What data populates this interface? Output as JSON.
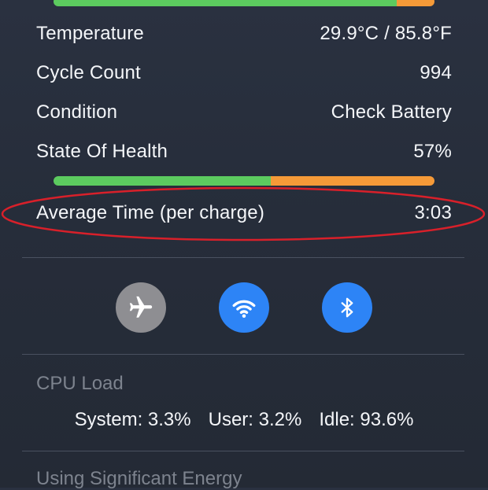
{
  "battery": {
    "top_bar_green_fraction": 0.9,
    "temperature": {
      "label": "Temperature",
      "value": "29.9°C / 85.8°F"
    },
    "cycle_count": {
      "label": "Cycle Count",
      "value": "994"
    },
    "condition": {
      "label": "Condition",
      "value": "Check Battery"
    },
    "state_of_health": {
      "label": "State Of Health",
      "value": "57%",
      "fraction": 0.57
    },
    "average_time": {
      "label": "Average Time (per charge)",
      "value": "3:03"
    }
  },
  "toggles": {
    "airplane": {
      "icon": "airplane-icon",
      "state": "off"
    },
    "wifi": {
      "icon": "wifi-icon",
      "state": "on"
    },
    "bluetooth": {
      "icon": "bluetooth-icon",
      "state": "on"
    }
  },
  "cpu": {
    "title": "CPU Load",
    "system": "System: 3.3%",
    "user": "User: 3.2%",
    "idle": "Idle: 93.6%"
  },
  "energy": {
    "title": "Using Significant Energy"
  },
  "colors": {
    "bar_green": "#5ccb5f",
    "bar_orange": "#f59a38",
    "toggle_on": "#2d84f6",
    "toggle_off": "#8e8e92",
    "annotation_red": "#d8202a"
  }
}
